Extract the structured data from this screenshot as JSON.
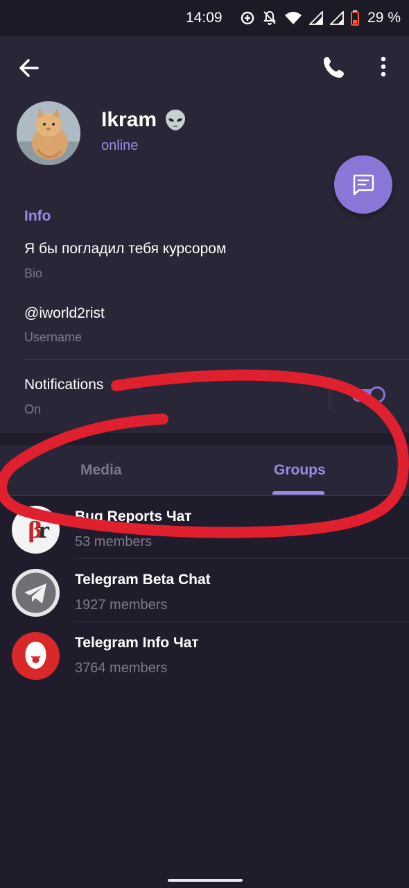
{
  "status_bar": {
    "time": "14:09",
    "battery_percent": "29 %",
    "icons": [
      "data-saver-icon",
      "notifications-off-icon",
      "wifi-icon",
      "signal-icon",
      "signal-icon",
      "battery-icon"
    ]
  },
  "header": {
    "back_icon": "arrow-back-icon",
    "call_icon": "phone-icon",
    "more_icon": "more-vert-icon",
    "name": "Ikram",
    "name_emoji": "alien-icon",
    "status": "online",
    "fab_icon": "message-icon"
  },
  "info": {
    "title": "Info",
    "bio_value": "Я бы погладил тебя курсором",
    "bio_label": "Bio",
    "username_value": "@iworld2rist",
    "username_label": "Username",
    "notifications_value": "Notifications",
    "notifications_label": "On",
    "notifications_enabled": true
  },
  "tabs": {
    "items": [
      {
        "label": "Media",
        "active": false
      },
      {
        "label": "Groups",
        "active": true
      }
    ]
  },
  "groups": [
    {
      "name": "Bug Reports Чат",
      "members": "53 members",
      "avatar": "br-logo-icon"
    },
    {
      "name": "Telegram Beta Chat",
      "members": "1927 members",
      "avatar": "telegram-plane-icon"
    },
    {
      "name": "Telegram Info Чат",
      "members": "3764 members",
      "avatar": "telegram-info-logo-icon"
    }
  ],
  "colors": {
    "background": "#1f1d2b",
    "surface": "#282637",
    "accent": "#9b8ce6",
    "fab": "#8a76d6",
    "marker": "#e0202e",
    "muted_text": "#7c7a8a"
  }
}
